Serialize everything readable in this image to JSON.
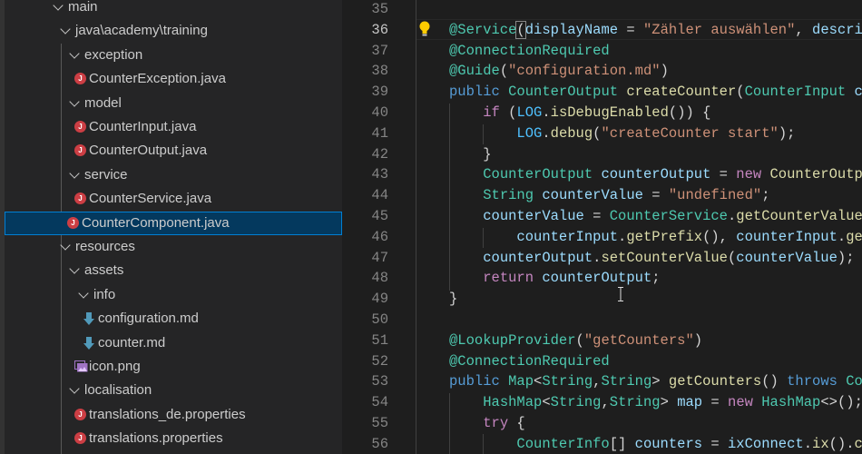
{
  "explorer": {
    "items": [
      {
        "label": "main",
        "type": "folder",
        "depth": 0
      },
      {
        "label": "java\\academy\\training",
        "type": "folder",
        "depth": 1
      },
      {
        "label": "exception",
        "type": "folder",
        "depth": 2
      },
      {
        "label": "CounterException.java",
        "type": "java",
        "depth": 3
      },
      {
        "label": "model",
        "type": "folder",
        "depth": 2
      },
      {
        "label": "CounterInput.java",
        "type": "java",
        "depth": 3
      },
      {
        "label": "CounterOutput.java",
        "type": "java",
        "depth": 3
      },
      {
        "label": "service",
        "type": "folder",
        "depth": 2
      },
      {
        "label": "CounterService.java",
        "type": "java",
        "depth": 3
      },
      {
        "label": "CounterComponent.java",
        "type": "java",
        "depth": 2,
        "selected": true
      },
      {
        "label": "resources",
        "type": "folder",
        "depth": 1
      },
      {
        "label": "assets",
        "type": "folder",
        "depth": 2
      },
      {
        "label": "info",
        "type": "folder",
        "depth": 3
      },
      {
        "label": "configuration.md",
        "type": "markdown",
        "depth": 4
      },
      {
        "label": "counter.md",
        "type": "markdown",
        "depth": 4
      },
      {
        "label": "icon.png",
        "type": "image",
        "depth": 3
      },
      {
        "label": "localisation",
        "type": "folder",
        "depth": 2
      },
      {
        "label": "translations_de.properties",
        "type": "java",
        "depth": 3
      },
      {
        "label": "translations.properties",
        "type": "java",
        "depth": 3
      }
    ],
    "java_icon_letter": "J",
    "colors": {
      "java_icon": "#cc3e44",
      "markdown_icon": "#519aba",
      "image_icon": "#a074c4",
      "selection_bg": "#04395e",
      "selection_border": "#007fd4"
    }
  },
  "editor": {
    "current_line": 36,
    "lines": [
      {
        "n": "35",
        "tokens": []
      },
      {
        "n": "36",
        "tokens": [
          [
            "@Service",
            "ann"
          ],
          [
            "(",
            "p"
          ],
          [
            "displayName",
            "var"
          ],
          [
            " = ",
            "p"
          ],
          [
            "\"Zähler auswählen\"",
            "str"
          ],
          [
            ", ",
            "p"
          ],
          [
            "descrip",
            "var"
          ]
        ]
      },
      {
        "n": "37",
        "tokens": [
          [
            "@ConnectionRequired",
            "ann"
          ]
        ]
      },
      {
        "n": "38",
        "tokens": [
          [
            "@Guide",
            "ann"
          ],
          [
            "(",
            "p"
          ],
          [
            "\"configuration.md\"",
            "str"
          ],
          [
            ")",
            "p"
          ]
        ]
      },
      {
        "n": "39",
        "tokens": [
          [
            "public ",
            "kw"
          ],
          [
            "CounterOutput ",
            "type"
          ],
          [
            "createCounter",
            "fn"
          ],
          [
            "(",
            "p"
          ],
          [
            "CounterInput ",
            "type"
          ],
          [
            "co",
            "var"
          ]
        ]
      },
      {
        "n": "40",
        "tokens": [
          [
            "    ",
            "p"
          ],
          [
            "if",
            "ctl"
          ],
          [
            " (",
            "p"
          ],
          [
            "LOG",
            "const"
          ],
          [
            ".",
            "p"
          ],
          [
            "isDebugEnabled",
            "fn"
          ],
          [
            "()) {",
            "p"
          ]
        ]
      },
      {
        "n": "41",
        "tokens": [
          [
            "        ",
            "p"
          ],
          [
            "LOG",
            "const"
          ],
          [
            ".",
            "p"
          ],
          [
            "debug",
            "fn"
          ],
          [
            "(",
            "p"
          ],
          [
            "\"createCounter start\"",
            "str"
          ],
          [
            ");",
            "p"
          ]
        ]
      },
      {
        "n": "42",
        "tokens": [
          [
            "    }",
            "p"
          ]
        ]
      },
      {
        "n": "43",
        "tokens": [
          [
            "    ",
            "p"
          ],
          [
            "CounterOutput ",
            "type"
          ],
          [
            "counterOutput",
            "var"
          ],
          [
            " = ",
            "p"
          ],
          [
            "new ",
            "ctl"
          ],
          [
            "CounterOutpu",
            "fn"
          ]
        ]
      },
      {
        "n": "44",
        "tokens": [
          [
            "    ",
            "p"
          ],
          [
            "String ",
            "type"
          ],
          [
            "counterValue",
            "var"
          ],
          [
            " = ",
            "p"
          ],
          [
            "\"undefined\"",
            "str"
          ],
          [
            ";",
            "p"
          ]
        ]
      },
      {
        "n": "45",
        "tokens": [
          [
            "    ",
            "p"
          ],
          [
            "counterValue",
            "var"
          ],
          [
            " = ",
            "p"
          ],
          [
            "CounterService",
            "type"
          ],
          [
            ".",
            "p"
          ],
          [
            "getCounterValue",
            "fn"
          ]
        ]
      },
      {
        "n": "46",
        "tokens": [
          [
            "        ",
            "p"
          ],
          [
            "counterInput",
            "var"
          ],
          [
            ".",
            "p"
          ],
          [
            "getPrefix",
            "fn"
          ],
          [
            "(), ",
            "p"
          ],
          [
            "counterInput",
            "var"
          ],
          [
            ".",
            "p"
          ],
          [
            "get",
            "fn"
          ]
        ]
      },
      {
        "n": "47",
        "tokens": [
          [
            "    ",
            "p"
          ],
          [
            "counterOutput",
            "var"
          ],
          [
            ".",
            "p"
          ],
          [
            "setCounterValue",
            "fn"
          ],
          [
            "(",
            "p"
          ],
          [
            "counterValue",
            "var"
          ],
          [
            ");",
            "p"
          ]
        ]
      },
      {
        "n": "48",
        "tokens": [
          [
            "    ",
            "p"
          ],
          [
            "return ",
            "ctl"
          ],
          [
            "counterOutput",
            "var"
          ],
          [
            ";",
            "p"
          ]
        ]
      },
      {
        "n": "49",
        "tokens": [
          [
            "}",
            "p"
          ]
        ]
      },
      {
        "n": "50",
        "tokens": []
      },
      {
        "n": "51",
        "tokens": [
          [
            "@LookupProvider",
            "ann"
          ],
          [
            "(",
            "p"
          ],
          [
            "\"getCounters\"",
            "str"
          ],
          [
            ")",
            "p"
          ]
        ]
      },
      {
        "n": "52",
        "tokens": [
          [
            "@ConnectionRequired",
            "ann"
          ]
        ]
      },
      {
        "n": "53",
        "tokens": [
          [
            "public ",
            "kw"
          ],
          [
            "Map",
            "type"
          ],
          [
            "<",
            "p"
          ],
          [
            "String",
            "type"
          ],
          [
            ",",
            "p"
          ],
          [
            "String",
            "type"
          ],
          [
            "> ",
            "p"
          ],
          [
            "getCounters",
            "fn"
          ],
          [
            "() ",
            "p"
          ],
          [
            "throws ",
            "kw"
          ],
          [
            "Cou",
            "type"
          ]
        ]
      },
      {
        "n": "54",
        "tokens": [
          [
            "    ",
            "p"
          ],
          [
            "HashMap",
            "type"
          ],
          [
            "<",
            "p"
          ],
          [
            "String",
            "type"
          ],
          [
            ",",
            "p"
          ],
          [
            "String",
            "type"
          ],
          [
            "> ",
            "p"
          ],
          [
            "map",
            "var"
          ],
          [
            " = ",
            "p"
          ],
          [
            "new ",
            "ctl"
          ],
          [
            "HashMap",
            "type"
          ],
          [
            "<>();",
            "p"
          ]
        ]
      },
      {
        "n": "55",
        "tokens": [
          [
            "    ",
            "p"
          ],
          [
            "try",
            "ctl"
          ],
          [
            " {",
            "p"
          ]
        ]
      },
      {
        "n": "56",
        "tokens": [
          [
            "        ",
            "p"
          ],
          [
            "CounterInfo",
            "type"
          ],
          [
            "[] ",
            "p"
          ],
          [
            "counters",
            "var"
          ],
          [
            " = ",
            "p"
          ],
          [
            "ixConnect",
            "var"
          ],
          [
            ".",
            "p"
          ],
          [
            "ix",
            "fn"
          ],
          [
            "().",
            "p"
          ],
          [
            "cl",
            "fn"
          ]
        ]
      }
    ],
    "lightbulb_icon": "lightbulb-icon",
    "colors": {
      "background": "#1e1e1e",
      "annotation": "#4ec9b0",
      "keyword": "#569cd6",
      "control": "#c586c0",
      "string": "#ce9178",
      "variable": "#9cdcfe",
      "function": "#dcdcaa"
    }
  }
}
